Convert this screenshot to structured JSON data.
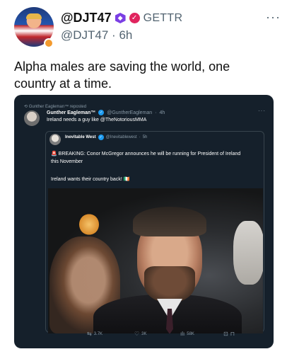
{
  "post": {
    "display_name": "@DJT47",
    "badge_icon": "purple-hexagon-badge-icon",
    "verified_icon": "red-check-badge-icon",
    "platform": "GETTR",
    "handle": "@DJT47",
    "separator": " · ",
    "time": "6h",
    "more": "···",
    "text": "Alpha males are saving the world, one country at a time."
  },
  "embed": {
    "repost_label": "Gunther Eagleman™ reposted",
    "author": {
      "name": "Gunther Eagleman™",
      "handle": "@GuntherEagleman",
      "time": "4h",
      "text": "Ireland needs a guy like @TheNotoriousMMA",
      "more": "···"
    },
    "quote": {
      "name": "Inevitable West",
      "handle": "@Inevitablewest",
      "time": "5h",
      "line1": "BREAKING: Conor McGregor announces he will be running for President of Ireland",
      "line2": "this November",
      "line3": "Ireland wants their country back! 🇮🇪"
    },
    "actions": {
      "replies": "3.7K",
      "likes": "3K",
      "views": "58K"
    }
  },
  "colors": {
    "embed_bg": "#15202b",
    "badge_purple": "#7b3fe4",
    "badge_red": "#e0245e",
    "verified_blue": "#1d9bf0"
  }
}
